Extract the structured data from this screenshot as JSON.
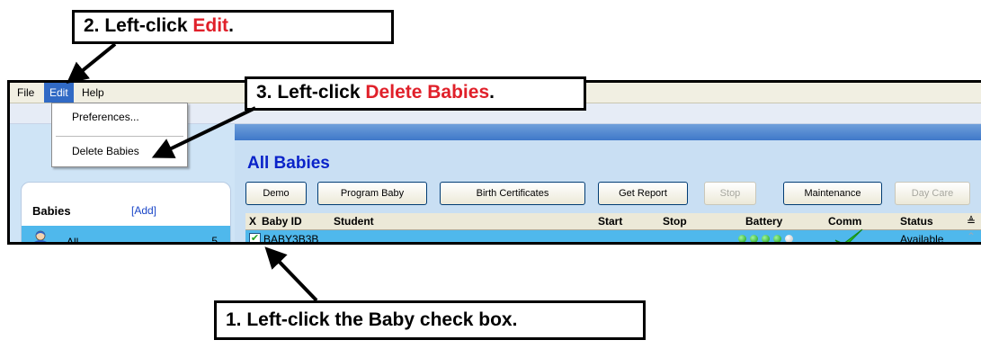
{
  "callouts": {
    "step2": {
      "prefix": "2.   Left-click ",
      "highlight": "Edit",
      "suffix": "."
    },
    "step3": {
      "prefix": "3.   Left-click ",
      "highlight": "Delete Babies",
      "suffix": "."
    },
    "step1": {
      "text": "1.   Left-click the Baby check box."
    }
  },
  "menubar": {
    "file": "File",
    "edit": "Edit",
    "help": "Help"
  },
  "edit_menu": {
    "preferences": "Preferences...",
    "delete_babies": "Delete Babies"
  },
  "sidebar": {
    "title": "Babies",
    "add": "[Add]",
    "all_label": "All",
    "all_count": "5"
  },
  "main": {
    "title": "All Babies",
    "buttons": [
      "Demo",
      "Program Baby",
      "Birth Certificates",
      "Get Report",
      "Stop",
      "Maintenance",
      "Day Care"
    ],
    "disabled_buttons": [
      "Stop",
      "Day Care"
    ]
  },
  "grid": {
    "columns": [
      "X",
      "Baby ID",
      "Student",
      "Start",
      "Stop",
      "Battery",
      "Comm",
      "Status"
    ],
    "rows": [
      {
        "checked": true,
        "baby_id": "BABY3B3B",
        "student": "",
        "start": "",
        "stop": "",
        "battery_level": 4,
        "battery_max": 5,
        "comm": "check-icon",
        "status": "Available"
      }
    ]
  },
  "colors": {
    "highlight_red": "#e0202a",
    "title_blue": "#0a23c9",
    "row_blue": "#4fb8ec",
    "menu_active": "#316ac5"
  }
}
